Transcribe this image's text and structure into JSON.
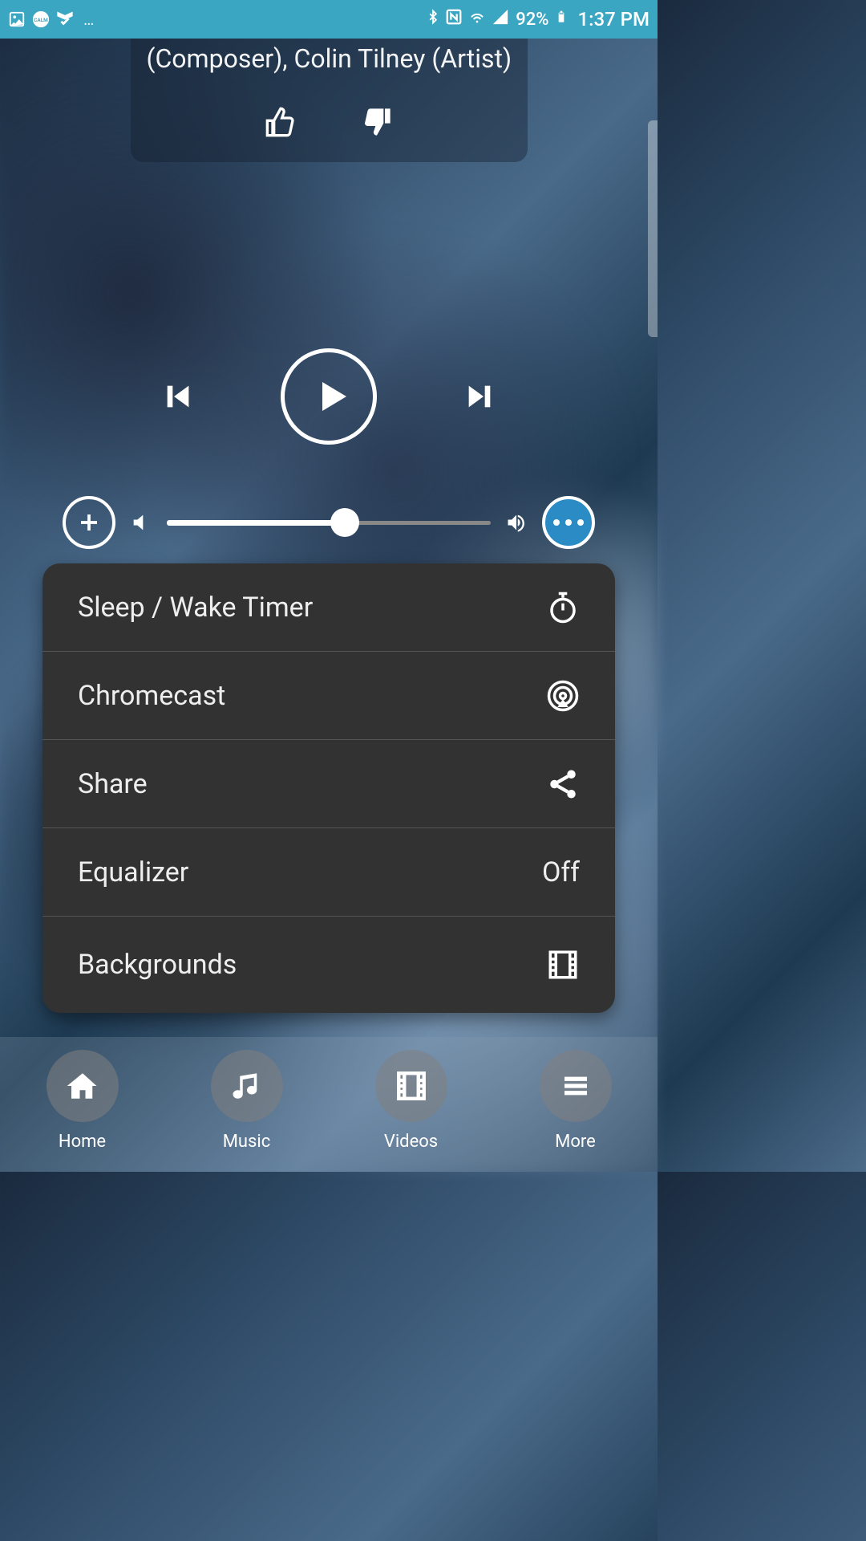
{
  "status": {
    "battery_percent": "92%",
    "time": "1:37 PM"
  },
  "track": {
    "artist_line": "(Composer), Colin Tilney (Artist)"
  },
  "volume": {
    "percent": 55
  },
  "menu": {
    "items": [
      {
        "label": "Sleep / Wake Timer",
        "right_text": "",
        "icon": "timer"
      },
      {
        "label": "Chromecast",
        "right_text": "",
        "icon": "cast"
      },
      {
        "label": "Share",
        "right_text": "",
        "icon": "share"
      },
      {
        "label": "Equalizer",
        "right_text": "Off",
        "icon": ""
      },
      {
        "label": "Backgrounds",
        "right_text": "",
        "icon": "film"
      }
    ]
  },
  "nav": {
    "items": [
      {
        "label": "Home",
        "icon": "home"
      },
      {
        "label": "Music",
        "icon": "music"
      },
      {
        "label": "Videos",
        "icon": "film"
      },
      {
        "label": "More",
        "icon": "menu"
      }
    ]
  }
}
